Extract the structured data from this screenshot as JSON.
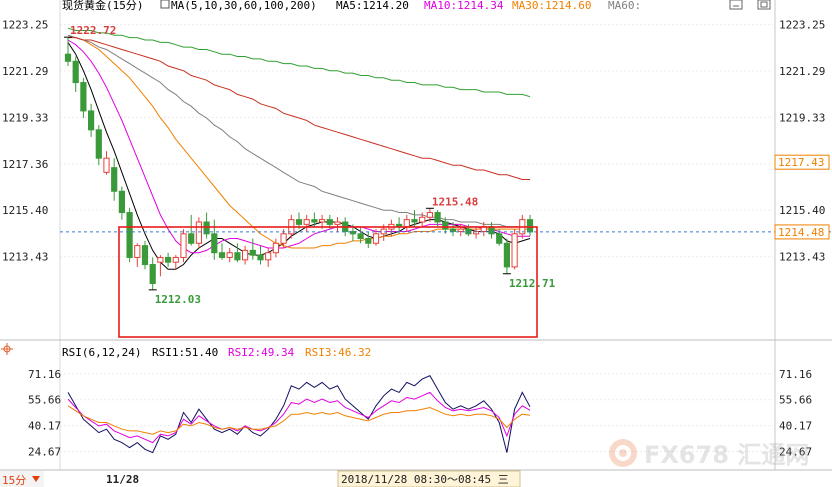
{
  "header": {
    "title": "现货黄金(15分)",
    "ma_params": "MA(5,10,30,60,100,200)",
    "ma5": "MA5:1214.20",
    "ma10": "MA10:1214.34",
    "ma30": "MA30:1214.60",
    "ma60": "MA60:"
  },
  "rsi_header": {
    "params": "RSI(6,12,24)",
    "rsi1": "RSI1:51.40",
    "rsi2": "RSI2:49.34",
    "rsi3": "RSI3:46.32"
  },
  "footer": {
    "period": "15分",
    "date": "11/28",
    "cursor_time": "2018/11/28 08:30～08:45 三"
  },
  "watermark": {
    "text": "FX678 汇通网"
  },
  "colors": {
    "up": "#e8413a",
    "down": "#3a9a3a",
    "ma5": "#000000",
    "ma10": "#e000e0",
    "ma30": "#f08000",
    "ma60": "#808080",
    "ma100": "#c83020",
    "ma200": "#30a030",
    "highlight_box": "#e81c1c",
    "price_line": "#3a7ad0"
  },
  "chart_data": [
    {
      "type": "candlestick",
      "title": "现货黄金(15分)",
      "y_ticks": [
        1223.25,
        1221.29,
        1219.33,
        1217.36,
        1215.4,
        1213.43
      ],
      "y_tick_labels": [
        "1223.25",
        "1221.29",
        "1219.33",
        "1217.36",
        "1215.40",
        "1213.43"
      ],
      "ylim": [
        1211.6,
        1223.7
      ],
      "current_price": 1214.48,
      "current_price_label": "1214.48",
      "marker_price": 1217.43,
      "marker_price_label": "1217.43",
      "annotations": [
        {
          "label": "1222.72",
          "value": 1222.72,
          "kind": "high"
        },
        {
          "label": "1212.03",
          "value": 1212.03,
          "kind": "low"
        },
        {
          "label": "1215.48",
          "value": 1215.48,
          "kind": "high"
        },
        {
          "label": "1212.71",
          "value": 1212.71,
          "kind": "low"
        }
      ],
      "candles": [
        {
          "o": 1222.0,
          "h": 1222.72,
          "l": 1221.5,
          "c": 1221.7
        },
        {
          "o": 1221.7,
          "h": 1221.9,
          "l": 1220.4,
          "c": 1220.8
        },
        {
          "o": 1220.8,
          "h": 1221.0,
          "l": 1219.3,
          "c": 1219.6
        },
        {
          "o": 1219.6,
          "h": 1219.9,
          "l": 1218.5,
          "c": 1218.8
        },
        {
          "o": 1218.8,
          "h": 1219.0,
          "l": 1217.3,
          "c": 1217.6
        },
        {
          "o": 1217.0,
          "h": 1217.9,
          "l": 1216.9,
          "c": 1217.6
        },
        {
          "o": 1217.2,
          "h": 1217.6,
          "l": 1215.8,
          "c": 1216.2
        },
        {
          "o": 1216.2,
          "h": 1216.4,
          "l": 1215.0,
          "c": 1215.3
        },
        {
          "o": 1215.3,
          "h": 1215.5,
          "l": 1213.2,
          "c": 1213.4
        },
        {
          "o": 1213.4,
          "h": 1214.0,
          "l": 1213.0,
          "c": 1213.9
        },
        {
          "o": 1213.9,
          "h": 1214.1,
          "l": 1212.9,
          "c": 1213.1
        },
        {
          "o": 1213.1,
          "h": 1213.4,
          "l": 1212.03,
          "c": 1212.3
        },
        {
          "o": 1213.2,
          "h": 1213.5,
          "l": 1212.6,
          "c": 1213.4
        },
        {
          "o": 1213.4,
          "h": 1213.6,
          "l": 1213.0,
          "c": 1213.2
        },
        {
          "o": 1213.2,
          "h": 1213.5,
          "l": 1212.9,
          "c": 1213.4
        },
        {
          "o": 1213.4,
          "h": 1214.6,
          "l": 1213.2,
          "c": 1214.4
        },
        {
          "o": 1214.4,
          "h": 1215.2,
          "l": 1213.9,
          "c": 1214.0
        },
        {
          "o": 1214.0,
          "h": 1215.1,
          "l": 1213.8,
          "c": 1214.9
        },
        {
          "o": 1214.9,
          "h": 1215.3,
          "l": 1214.2,
          "c": 1214.4
        },
        {
          "o": 1214.4,
          "h": 1215.0,
          "l": 1213.3,
          "c": 1213.6
        },
        {
          "o": 1213.6,
          "h": 1214.0,
          "l": 1213.3,
          "c": 1213.4
        },
        {
          "o": 1213.4,
          "h": 1213.8,
          "l": 1213.2,
          "c": 1213.6
        },
        {
          "o": 1213.6,
          "h": 1214.0,
          "l": 1213.2,
          "c": 1213.3
        },
        {
          "o": 1213.3,
          "h": 1213.9,
          "l": 1213.1,
          "c": 1213.7
        },
        {
          "o": 1213.7,
          "h": 1214.2,
          "l": 1213.3,
          "c": 1213.5
        },
        {
          "o": 1213.5,
          "h": 1213.9,
          "l": 1213.1,
          "c": 1213.3
        },
        {
          "o": 1213.3,
          "h": 1213.8,
          "l": 1213.0,
          "c": 1213.6
        },
        {
          "o": 1213.6,
          "h": 1214.2,
          "l": 1213.4,
          "c": 1214.0
        },
        {
          "o": 1214.0,
          "h": 1214.6,
          "l": 1213.8,
          "c": 1214.4
        },
        {
          "o": 1214.4,
          "h": 1215.2,
          "l": 1214.2,
          "c": 1215.0
        },
        {
          "o": 1215.0,
          "h": 1215.3,
          "l": 1214.6,
          "c": 1214.8
        },
        {
          "o": 1214.8,
          "h": 1215.2,
          "l": 1214.5,
          "c": 1215.0
        },
        {
          "o": 1215.0,
          "h": 1215.3,
          "l": 1214.7,
          "c": 1214.9
        },
        {
          "o": 1214.9,
          "h": 1215.2,
          "l": 1214.6,
          "c": 1215.0
        },
        {
          "o": 1215.0,
          "h": 1215.2,
          "l": 1214.6,
          "c": 1214.8
        },
        {
          "o": 1214.8,
          "h": 1215.1,
          "l": 1214.5,
          "c": 1214.9
        },
        {
          "o": 1214.9,
          "h": 1215.1,
          "l": 1214.3,
          "c": 1214.5
        },
        {
          "o": 1214.5,
          "h": 1214.8,
          "l": 1214.1,
          "c": 1214.4
        },
        {
          "o": 1214.4,
          "h": 1214.7,
          "l": 1214.0,
          "c": 1214.2
        },
        {
          "o": 1214.2,
          "h": 1214.5,
          "l": 1213.8,
          "c": 1214.0
        },
        {
          "o": 1214.0,
          "h": 1214.6,
          "l": 1213.9,
          "c": 1214.4
        },
        {
          "o": 1214.4,
          "h": 1214.8,
          "l": 1214.1,
          "c": 1214.6
        },
        {
          "o": 1214.6,
          "h": 1215.0,
          "l": 1214.3,
          "c": 1214.8
        },
        {
          "o": 1214.8,
          "h": 1215.1,
          "l": 1214.4,
          "c": 1214.7
        },
        {
          "o": 1214.7,
          "h": 1215.2,
          "l": 1214.5,
          "c": 1215.0
        },
        {
          "o": 1215.0,
          "h": 1215.4,
          "l": 1214.7,
          "c": 1214.9
        },
        {
          "o": 1214.9,
          "h": 1215.3,
          "l": 1214.7,
          "c": 1215.1
        },
        {
          "o": 1215.1,
          "h": 1215.48,
          "l": 1214.9,
          "c": 1215.3
        },
        {
          "o": 1215.3,
          "h": 1215.4,
          "l": 1214.7,
          "c": 1214.9
        },
        {
          "o": 1214.9,
          "h": 1215.1,
          "l": 1214.4,
          "c": 1214.6
        },
        {
          "o": 1214.6,
          "h": 1214.9,
          "l": 1214.3,
          "c": 1214.5
        },
        {
          "o": 1214.5,
          "h": 1214.8,
          "l": 1214.3,
          "c": 1214.6
        },
        {
          "o": 1214.6,
          "h": 1214.8,
          "l": 1214.3,
          "c": 1214.4
        },
        {
          "o": 1214.4,
          "h": 1214.7,
          "l": 1214.2,
          "c": 1214.5
        },
        {
          "o": 1214.5,
          "h": 1214.9,
          "l": 1214.3,
          "c": 1214.7
        },
        {
          "o": 1214.7,
          "h": 1214.9,
          "l": 1214.2,
          "c": 1214.4
        },
        {
          "o": 1214.4,
          "h": 1214.6,
          "l": 1213.9,
          "c": 1214.0
        },
        {
          "o": 1214.0,
          "h": 1214.2,
          "l": 1212.71,
          "c": 1213.0
        },
        {
          "o": 1213.0,
          "h": 1214.6,
          "l": 1212.9,
          "c": 1214.4
        },
        {
          "o": 1214.4,
          "h": 1215.2,
          "l": 1214.2,
          "c": 1215.0
        },
        {
          "o": 1215.0,
          "h": 1215.2,
          "l": 1214.3,
          "c": 1214.48
        }
      ],
      "moving_averages": [
        {
          "name": "MA5",
          "values": [
            1222.5,
            1222.0,
            1221.3,
            1220.5,
            1219.6,
            1218.7,
            1217.9,
            1217.0,
            1216.1,
            1215.2,
            1214.4,
            1213.7,
            1213.2,
            1212.9,
            1212.9,
            1213.1,
            1213.5,
            1213.8,
            1214.0,
            1214.2,
            1214.2,
            1214.0,
            1213.8,
            1213.6,
            1213.5,
            1213.5,
            1213.6,
            1213.8,
            1214.0,
            1214.3,
            1214.5,
            1214.7,
            1214.8,
            1214.9,
            1214.9,
            1214.9,
            1214.8,
            1214.7,
            1214.5,
            1214.3,
            1214.2,
            1214.3,
            1214.4,
            1214.5,
            1214.7,
            1214.8,
            1214.9,
            1215.0,
            1215.0,
            1214.9,
            1214.8,
            1214.7,
            1214.6,
            1214.5,
            1214.5,
            1214.5,
            1214.4,
            1214.1,
            1214.0,
            1214.1,
            1214.2
          ]
        },
        {
          "name": "MA10",
          "values": [
            1222.6,
            1222.4,
            1222.1,
            1221.7,
            1221.2,
            1220.6,
            1219.9,
            1219.2,
            1218.4,
            1217.6,
            1216.8,
            1216.0,
            1215.2,
            1214.6,
            1214.1,
            1213.8,
            1213.6,
            1213.6,
            1213.7,
            1213.9,
            1214.1,
            1214.2,
            1214.2,
            1214.1,
            1214.0,
            1213.9,
            1213.8,
            1213.8,
            1213.8,
            1213.9,
            1214.0,
            1214.2,
            1214.4,
            1214.5,
            1214.6,
            1214.7,
            1214.7,
            1214.7,
            1214.7,
            1214.6,
            1214.5,
            1214.5,
            1214.5,
            1214.5,
            1214.5,
            1214.6,
            1214.7,
            1214.8,
            1214.8,
            1214.8,
            1214.8,
            1214.8,
            1214.7,
            1214.7,
            1214.6,
            1214.6,
            1214.5,
            1214.4,
            1214.3,
            1214.3,
            1214.3
          ]
        },
        {
          "name": "MA30",
          "values": [
            1222.8,
            1222.7,
            1222.6,
            1222.4,
            1222.2,
            1221.9,
            1221.6,
            1221.3,
            1221.0,
            1220.6,
            1220.2,
            1219.8,
            1219.3,
            1218.9,
            1218.4,
            1218.0,
            1217.6,
            1217.2,
            1216.8,
            1216.4,
            1216.0,
            1215.6,
            1215.3,
            1215.0,
            1214.7,
            1214.4,
            1214.2,
            1214.0,
            1213.9,
            1213.8,
            1213.8,
            1213.8,
            1213.8,
            1213.9,
            1213.9,
            1214.0,
            1214.0,
            1214.1,
            1214.1,
            1214.2,
            1214.2,
            1214.3,
            1214.3,
            1214.4,
            1214.4,
            1214.5,
            1214.5,
            1214.5,
            1214.6,
            1214.6,
            1214.6,
            1214.6,
            1214.6,
            1214.6,
            1214.6,
            1214.6,
            1214.6,
            1214.6,
            1214.6,
            1214.6,
            1214.6
          ]
        },
        {
          "name": "MA60",
          "values": [
            1222.8,
            1222.7,
            1222.6,
            1222.5,
            1222.3,
            1222.2,
            1222.0,
            1221.8,
            1221.6,
            1221.4,
            1221.2,
            1221.0,
            1220.8,
            1220.5,
            1220.3,
            1220.0,
            1219.8,
            1219.5,
            1219.3,
            1219.0,
            1218.8,
            1218.5,
            1218.3,
            1218.0,
            1217.8,
            1217.6,
            1217.4,
            1217.2,
            1217.0,
            1216.8,
            1216.6,
            1216.5,
            1216.4,
            1216.2,
            1216.1,
            1216.0,
            1215.9,
            1215.8,
            1215.7,
            1215.6,
            1215.5,
            1215.4,
            1215.4,
            1215.3,
            1215.3,
            1215.2,
            1215.2,
            1215.1,
            1215.1,
            1215.0,
            1215.0,
            1214.9,
            1214.9,
            1214.9,
            1214.8,
            1214.8,
            1214.8,
            1214.7,
            1214.7,
            1214.7,
            1214.7
          ]
        },
        {
          "name": "MA100",
          "values": [
            1222.7,
            1222.7,
            1222.6,
            1222.6,
            1222.5,
            1222.4,
            1222.3,
            1222.2,
            1222.1,
            1222.0,
            1221.9,
            1221.8,
            1221.7,
            1221.5,
            1221.4,
            1221.3,
            1221.1,
            1221.0,
            1220.9,
            1220.7,
            1220.6,
            1220.5,
            1220.3,
            1220.2,
            1220.1,
            1219.9,
            1219.8,
            1219.7,
            1219.5,
            1219.4,
            1219.3,
            1219.2,
            1219.0,
            1218.9,
            1218.8,
            1218.7,
            1218.6,
            1218.5,
            1218.4,
            1218.3,
            1218.2,
            1218.1,
            1218.0,
            1217.9,
            1217.8,
            1217.7,
            1217.6,
            1217.6,
            1217.5,
            1217.4,
            1217.3,
            1217.3,
            1217.2,
            1217.1,
            1217.1,
            1217.0,
            1216.9,
            1216.9,
            1216.8,
            1216.7,
            1216.7
          ]
        },
        {
          "name": "MA200",
          "values": [
            1223.1,
            1223.0,
            1223.0,
            1223.0,
            1222.9,
            1222.9,
            1222.8,
            1222.8,
            1222.7,
            1222.7,
            1222.6,
            1222.6,
            1222.5,
            1222.5,
            1222.4,
            1222.3,
            1222.3,
            1222.2,
            1222.2,
            1222.1,
            1222.0,
            1222.0,
            1221.9,
            1221.9,
            1221.8,
            1221.8,
            1221.7,
            1221.7,
            1221.6,
            1221.6,
            1221.5,
            1221.5,
            1221.4,
            1221.4,
            1221.3,
            1221.3,
            1221.2,
            1221.2,
            1221.1,
            1221.1,
            1221.0,
            1221.0,
            1220.9,
            1220.9,
            1220.8,
            1220.8,
            1220.7,
            1220.7,
            1220.7,
            1220.6,
            1220.6,
            1220.5,
            1220.5,
            1220.5,
            1220.4,
            1220.4,
            1220.4,
            1220.3,
            1220.3,
            1220.3,
            1220.2
          ]
        }
      ]
    },
    {
      "type": "line",
      "title": "RSI(6,12,24)",
      "y_ticks": [
        71.16,
        55.66,
        40.17,
        24.67
      ],
      "y_tick_labels": [
        "71.16",
        "55.66",
        "40.17",
        "24.67"
      ],
      "ylim": [
        16,
        80
      ],
      "series": [
        {
          "name": "RSI1",
          "values": [
            60,
            52,
            44,
            40,
            36,
            38,
            32,
            30,
            27,
            30,
            26,
            24,
            34,
            32,
            35,
            48,
            42,
            50,
            44,
            38,
            36,
            38,
            35,
            40,
            36,
            34,
            38,
            44,
            52,
            64,
            62,
            66,
            63,
            66,
            62,
            64,
            56,
            52,
            48,
            44,
            52,
            58,
            62,
            60,
            66,
            64,
            68,
            70,
            62,
            54,
            50,
            52,
            50,
            52,
            55,
            50,
            42,
            24,
            50,
            60,
            51.4
          ]
        },
        {
          "name": "RSI2",
          "values": [
            56,
            51,
            46,
            43,
            40,
            41,
            37,
            35,
            33,
            34,
            32,
            30,
            35,
            34,
            36,
            44,
            41,
            46,
            43,
            40,
            38,
            39,
            37,
            40,
            38,
            37,
            39,
            42,
            47,
            54,
            53,
            56,
            54,
            56,
            54,
            55,
            51,
            49,
            47,
            45,
            49,
            52,
            55,
            54,
            57,
            56,
            58,
            60,
            55,
            51,
            49,
            50,
            49,
            50,
            51,
            49,
            45,
            34,
            47,
            52,
            49.34
          ]
        },
        {
          "name": "RSI3",
          "values": [
            52,
            49,
            46,
            44,
            42,
            42,
            40,
            38,
            37,
            37,
            36,
            35,
            37,
            36,
            37,
            41,
            40,
            42,
            41,
            39,
            38,
            39,
            38,
            39,
            38,
            38,
            39,
            40,
            43,
            47,
            47,
            48,
            47,
            48,
            47,
            48,
            46,
            45,
            44,
            43,
            45,
            47,
            48,
            48,
            49,
            49,
            50,
            51,
            49,
            47,
            46,
            47,
            46,
            47,
            47,
            46,
            44,
            39,
            44,
            47,
            46.32
          ]
        }
      ]
    }
  ]
}
